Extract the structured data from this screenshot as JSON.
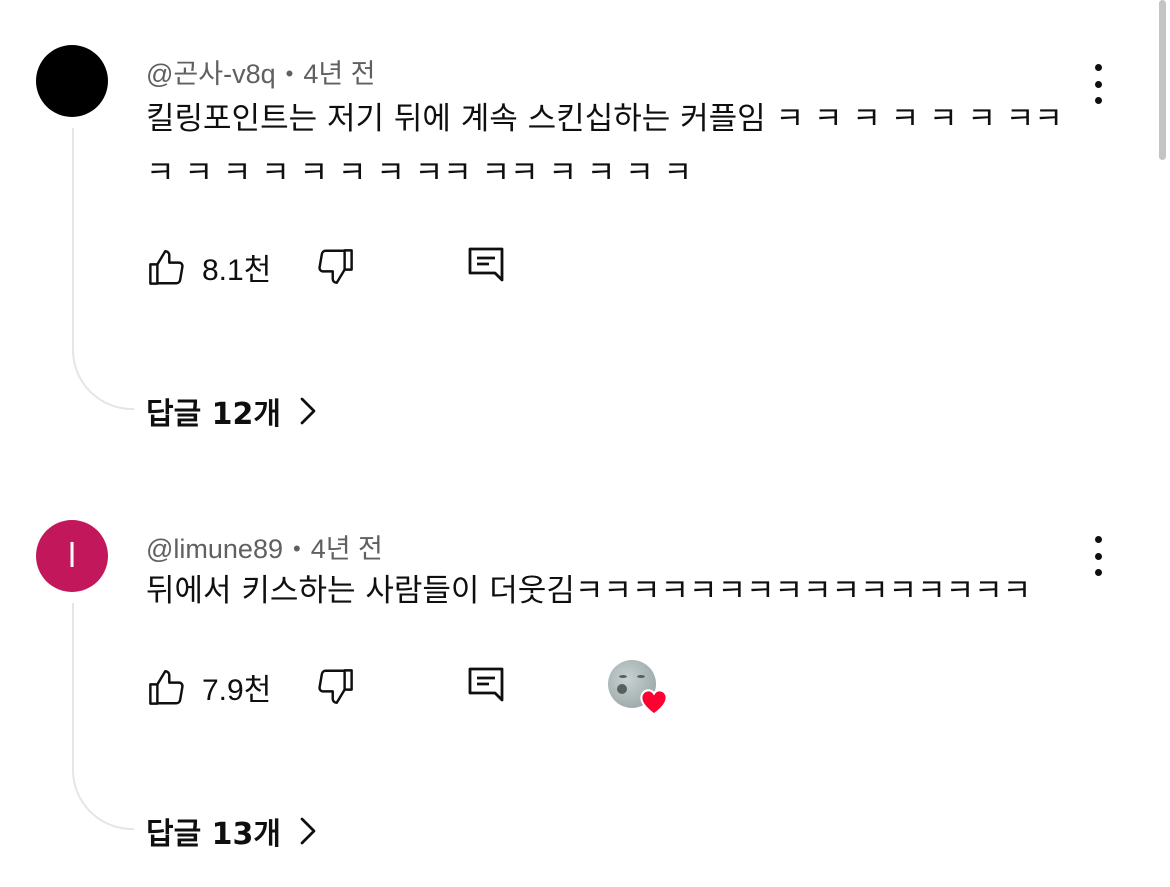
{
  "comments": [
    {
      "handle": "@곤사-v8q",
      "time": "4년 전",
      "avatar_letter": "",
      "avatar_color": "#000000",
      "text": "킬링포인트는 저기 뒤에 계속 스킨십하는 커플임 ㅋ ㅋ ㅋ ㅋ ㅋ ㅋ ㅋㅋㅋ ㅋ ㅋ ㅋ ㅋ ㅋ ㅋ ㅋㅋ ㅋㅋ ㅋ ㅋ ㅋ ㅋ",
      "likes": "8.1천",
      "replies": "답글 12개",
      "creator_heart": false
    },
    {
      "handle": "@limune89",
      "time": "4년 전",
      "avatar_letter": "l",
      "avatar_color": "#c2185b",
      "text": "뒤에서 키스하는 사람들이 더웃김ㅋㅋㅋㅋㅋㅋㅋㅋㅋㅋㅋㅋㅋㅋㅋㅋ",
      "likes": "7.9천",
      "replies": "답글 13개",
      "creator_heart": true
    }
  ],
  "icons": {
    "like": "thumbs-up-icon",
    "dislike": "thumbs-down-icon",
    "reply": "reply-icon",
    "more": "more-vertical-icon",
    "replies_arrow": "chevron-right-icon",
    "creator_heart": "heart-icon"
  },
  "colors": {
    "heart": "#ff0033",
    "meta_text": "#606060",
    "thread_line": "#e5e5e5"
  }
}
